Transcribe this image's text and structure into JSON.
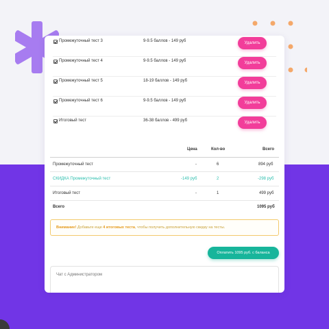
{
  "tests": [
    {
      "name": "Промежуточный тест 3",
      "info": "9-9.5 баллов - 149 руб",
      "button": "Удалить"
    },
    {
      "name": "Промежуточный тест 4",
      "info": "9-9.5 баллов - 149 руб",
      "button": "Удалить"
    },
    {
      "name": "Промежуточный тест 5",
      "info": "18-19 баллов - 149 руб",
      "button": "Удалить"
    },
    {
      "name": "Промежуточный тест 6",
      "info": "9-9.5 баллов - 149 руб",
      "button": "Удалить"
    },
    {
      "name": "Итоговый тест",
      "info": "36-38 баллов - 499 руб",
      "button": "Удалить"
    }
  ],
  "summary": {
    "headers": {
      "price": "Цена",
      "qty": "Кол-во",
      "total": "Всего"
    },
    "rows": [
      {
        "name": "Промежуточный тест",
        "price": "-",
        "qty": "6",
        "total": "894 руб"
      },
      {
        "name": "СКИДКА Промежуточный тест",
        "price": "-149 руб",
        "qty": "2",
        "total": "-298 руб"
      },
      {
        "name": "Итоговый тест",
        "price": "-",
        "qty": "1",
        "total": "499 руб"
      }
    ],
    "grand": {
      "label": "Всего",
      "total": "1095 руб"
    }
  },
  "notice": {
    "attention": "Внимание!",
    "text1": " Добавьте еще ",
    "highlight": "4 итоговых теста",
    "text2": ", чтобы получить дополнительную скидку на тесты."
  },
  "pay_button": "Оплатить 1095 руб. с баланса",
  "chat": {
    "placeholder": "Чат с Администратором"
  },
  "colors": {
    "accent_purple": "#7135e6",
    "delete_pink": "#f23d9a",
    "pay_teal": "#17b59b",
    "discount_teal": "#2cbfae"
  }
}
